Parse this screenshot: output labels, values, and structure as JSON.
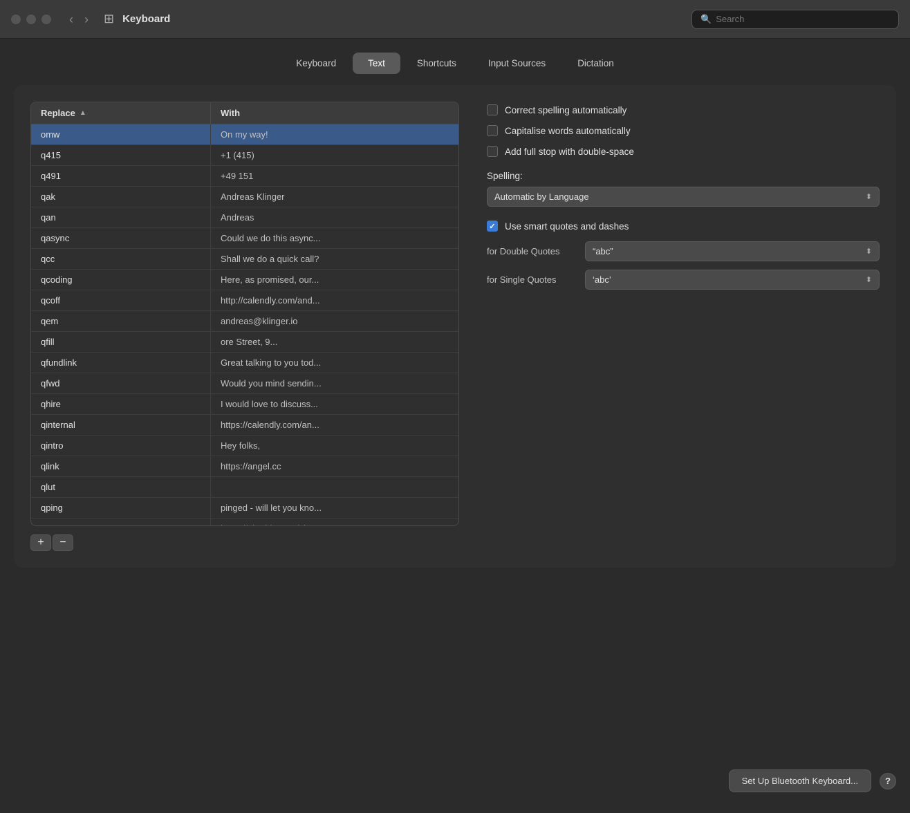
{
  "titlebar": {
    "title": "Keyboard",
    "search_placeholder": "Search"
  },
  "tabs": [
    {
      "id": "keyboard",
      "label": "Keyboard"
    },
    {
      "id": "text",
      "label": "Text",
      "active": true
    },
    {
      "id": "shortcuts",
      "label": "Shortcuts"
    },
    {
      "id": "input_sources",
      "label": "Input Sources"
    },
    {
      "id": "dictation",
      "label": "Dictation"
    }
  ],
  "table": {
    "col_replace": "Replace",
    "col_with": "With",
    "rows": [
      {
        "replace": "omw",
        "with": "On my way!",
        "selected": true
      },
      {
        "replace": "q415",
        "with": "+1 (415)"
      },
      {
        "replace": "q491",
        "with": "+49 151"
      },
      {
        "replace": "qak",
        "with": "Andreas Klinger"
      },
      {
        "replace": "qan",
        "with": "Andreas"
      },
      {
        "replace": "qasync",
        "with": "Could we do this async..."
      },
      {
        "replace": "qcc",
        "with": "Shall we do a quick call?"
      },
      {
        "replace": "qcoding",
        "with": "Here, as promised, our..."
      },
      {
        "replace": "qcoff",
        "with": "http://calendly.com/and..."
      },
      {
        "replace": "qem",
        "with": "andreas@klinger.io"
      },
      {
        "replace": "qfill",
        "with": "ore Street, 9..."
      },
      {
        "replace": "qfundlink",
        "with": "Great talking to you tod..."
      },
      {
        "replace": "qfwd",
        "with": "Would you mind sendin..."
      },
      {
        "replace": "qhire",
        "with": "I would love to discuss..."
      },
      {
        "replace": "qinternal",
        "with": "https://calendly.com/an..."
      },
      {
        "replace": "qintro",
        "with": "Hey folks,"
      },
      {
        "replace": "qlink",
        "with": "https://angel.cc"
      },
      {
        "replace": "qlut",
        "with": ""
      },
      {
        "replace": "qping",
        "with": "pinged - will let you kno..."
      },
      {
        "replace": "qport",
        "with": "https://airtable.com/shr"
      }
    ],
    "add_button": "+",
    "remove_button": "−"
  },
  "settings": {
    "correct_spelling_label": "Correct spelling automatically",
    "correct_spelling_checked": false,
    "capitalise_words_label": "Capitalise words automatically",
    "capitalise_words_checked": false,
    "add_full_stop_label": "Add full stop with double-space",
    "add_full_stop_checked": false,
    "spelling_label": "Spelling:",
    "spelling_dropdown": "Automatic by Language",
    "smart_quotes_label": "Use smart quotes and dashes",
    "smart_quotes_checked": true,
    "double_quotes_label": "for Double Quotes",
    "double_quotes_value": "“abc”",
    "single_quotes_label": "for Single Quotes",
    "single_quotes_value": "‘abc’"
  },
  "bottom": {
    "bluetooth_btn": "Set Up Bluetooth Keyboard...",
    "help_btn": "?"
  }
}
